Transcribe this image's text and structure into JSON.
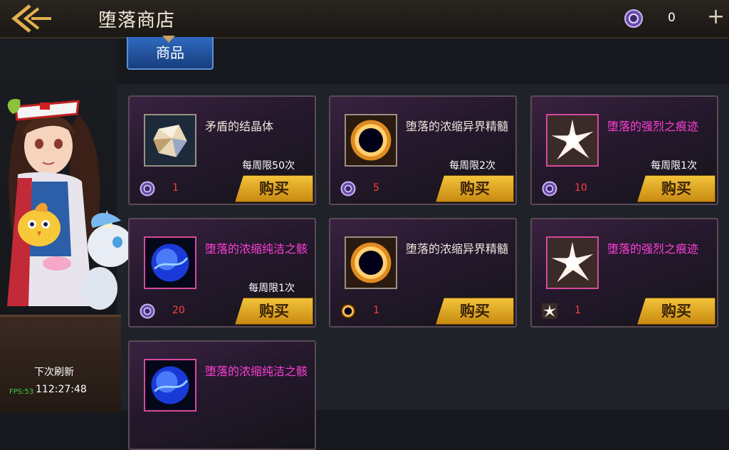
{
  "header": {
    "title": "堕落商店",
    "currency_value": "0"
  },
  "tab": {
    "label": "商品"
  },
  "refresh": {
    "label": "下次刷新",
    "time": "112:27:48"
  },
  "fps": "FPS:53",
  "items": [
    {
      "name": "矛盾的结晶体",
      "limit": "每周限50次",
      "price": "1",
      "price_icon": "purple-coin-icon",
      "buy": "购买",
      "icon": "crystal-icon",
      "name_color": "white"
    },
    {
      "name": "堕落的浓缩异界精髓",
      "limit": "每周限2次",
      "price": "5",
      "price_icon": "purple-coin-icon",
      "buy": "购买",
      "icon": "dark-sun-icon",
      "name_color": "white"
    },
    {
      "name": "堕落的强烈之痕迹",
      "limit": "每周限1次",
      "price": "10",
      "price_icon": "purple-coin-icon",
      "buy": "购买",
      "icon": "flash-burst-icon",
      "name_color": "magenta"
    },
    {
      "name": "堕落的浓缩纯洁之骸",
      "limit": "每周限1次",
      "price": "20",
      "price_icon": "purple-coin-icon",
      "buy": "购买",
      "icon": "blue-orb-icon",
      "name_color": "magenta"
    },
    {
      "name": "堕落的浓缩异界精髓",
      "limit": "",
      "price": "1",
      "price_icon": "dark-sun-icon",
      "buy": "购买",
      "icon": "dark-sun-icon",
      "name_color": "white"
    },
    {
      "name": "堕落的强烈之痕迹",
      "limit": "",
      "price": "1",
      "price_icon": "flash-burst-icon",
      "buy": "购买",
      "icon": "flash-burst-icon",
      "name_color": "magenta"
    },
    {
      "name": "堕落的浓缩纯洁之骸",
      "limit": "",
      "price": "",
      "price_icon": "",
      "buy": "",
      "icon": "blue-orb-icon",
      "name_color": "magenta"
    }
  ],
  "colors": {
    "accent_gold": "#e0a52a",
    "magenta_text": "#ff3fd6",
    "price_red": "#ff4040",
    "tab_blue": "#2f6ac0"
  }
}
